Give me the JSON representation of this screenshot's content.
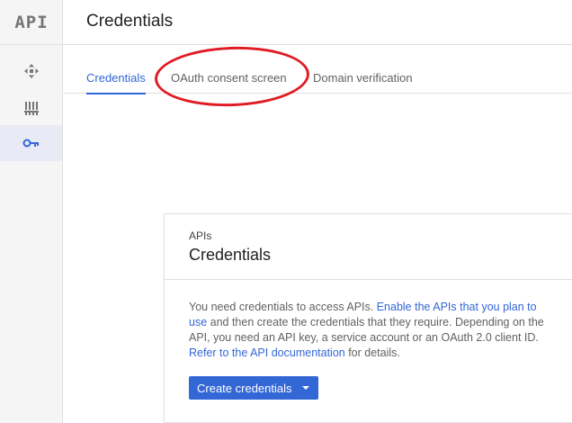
{
  "app": {
    "logo_text": "API"
  },
  "sidebar": {
    "items": [
      {
        "icon": "dashboard-icon",
        "active": false
      },
      {
        "icon": "library-icon",
        "active": false
      },
      {
        "icon": "key-icon",
        "active": true
      }
    ]
  },
  "header": {
    "title": "Credentials"
  },
  "tabs": [
    {
      "label": "Credentials",
      "active": true
    },
    {
      "label": "OAuth consent screen",
      "active": false
    },
    {
      "label": "Domain verification",
      "active": false
    }
  ],
  "card": {
    "kicker": "APIs",
    "title": "Credentials",
    "body": {
      "part1": "You need credentials to access APIs. ",
      "link1": "Enable the APIs that you plan to use",
      "part2": " and then create the credentials that they require. Depending on the API, you need an API key, a service account or an OAuth 2.0 client ID. ",
      "link2": "Refer to the API documentation",
      "part3": " for details."
    },
    "button_label": "Create credentials"
  },
  "colors": {
    "accent": "#3367d6",
    "annotation": "#e01b24",
    "sidebar_bg": "#f5f5f5",
    "active_nav_bg": "#e8eaf6"
  }
}
